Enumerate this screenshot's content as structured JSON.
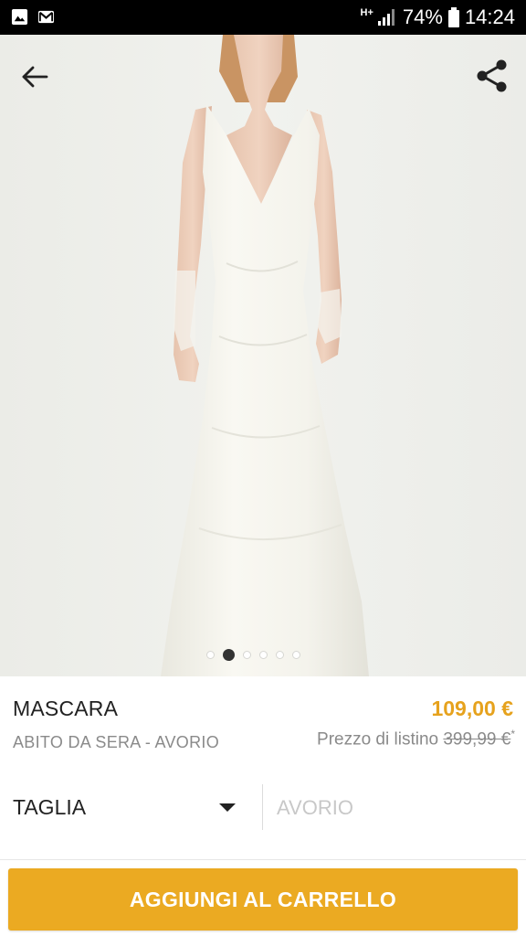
{
  "status_bar": {
    "network": "H+",
    "battery_percent": "74%",
    "time": "14:24",
    "left_icons": [
      "gallery-notification-icon",
      "gmail-notification-icon"
    ],
    "right_icons": [
      "signal-icon",
      "battery-icon"
    ]
  },
  "header": {
    "back_icon": "arrow-left-icon",
    "share_icon": "share-icon"
  },
  "gallery": {
    "image_count": 6,
    "active_index": 1
  },
  "product": {
    "name": "MASCARA",
    "subtitle": "ABITO DA SERA - AVORIO",
    "price": "109,00 €",
    "list_price_label": "Prezzo di listino",
    "list_price_value": "399,99 €",
    "list_price_mark": "*"
  },
  "options": {
    "size_label": "TAGLIA",
    "color_value": "AVORIO"
  },
  "cta": {
    "label": "AGGIUNGI AL CARRELLO"
  },
  "colors": {
    "accent": "#EBAA22",
    "price": "#E6A21D",
    "status_bar": "#000000"
  }
}
